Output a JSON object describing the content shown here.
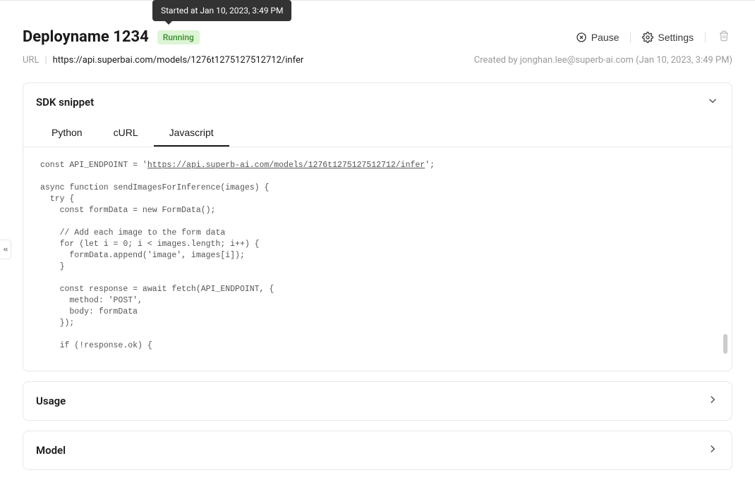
{
  "tooltip": "Started at Jan 10, 2023, 3:49 PM",
  "header": {
    "title": "Deployname 1234",
    "status": "Running",
    "pause_label": "Pause",
    "settings_label": "Settings"
  },
  "url": {
    "label": "URL",
    "value": "https://api.superbai.com/models/1276t1275127512712/infer"
  },
  "created_by": "Created by jonghan.lee@superb-ai.com (Jan 10, 2023, 3:49 PM)",
  "panels": {
    "sdk": {
      "title": "SDK snippet"
    },
    "usage": {
      "title": "Usage"
    },
    "model": {
      "title": "Model"
    }
  },
  "tabs": [
    "Python",
    "cURL",
    "Javascript"
  ],
  "code": {
    "l1a": "const API_ENDPOINT = '",
    "l1b": "https://api.superb-ai.com/models/1276t1275127512712/infer",
    "l1c": "';",
    "l2": "",
    "l3": "async function sendImagesForInference(images) {",
    "l4": "  try {",
    "l5": "    const formData = new FormData();",
    "l6": "",
    "l7": "    // Add each image to the form data",
    "l8": "    for (let i = 0; i < images.length; i++) {",
    "l9": "      formData.append('image', images[i]);",
    "l10": "    }",
    "l11": "",
    "l12": "    const response = await fetch(API_ENDPOINT, {",
    "l13": "      method: 'POST',",
    "l14": "      body: formData",
    "l15": "    });",
    "l16": "",
    "l17": "    if (!response.ok) {"
  }
}
